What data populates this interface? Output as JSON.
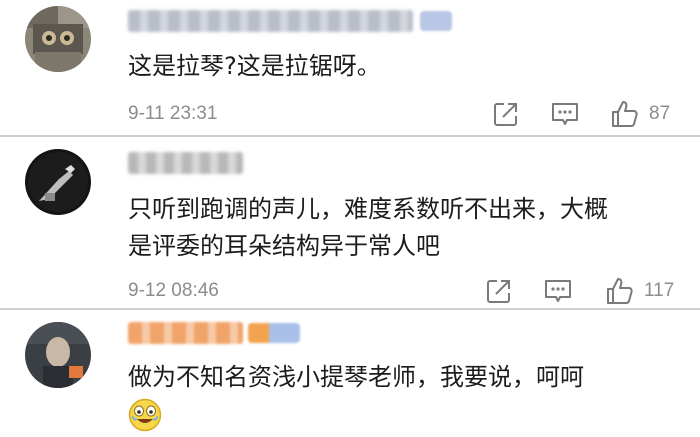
{
  "comments": [
    {
      "text_lines": [
        "这是拉琴?这是拉锯呀。"
      ],
      "time": "9-11 23:31",
      "likes": "87"
    },
    {
      "text_lines": [
        "只听到跑调的声儿，难度系数听不出来，大概",
        "是评委的耳朵结构异于常人吧"
      ],
      "time": "9-12 08:46",
      "likes": "117"
    },
    {
      "text_lines": [
        "做为不知名资浅小提琴老师，我要说，呵呵"
      ]
    }
  ],
  "colors": {
    "divider": "#cfcfcf",
    "meta_text": "#8c8c8c",
    "icon_stroke": "#7a7a7a"
  },
  "icons": [
    "share-icon",
    "reply-icon",
    "like-icon",
    "laughing-emoji-icon"
  ]
}
